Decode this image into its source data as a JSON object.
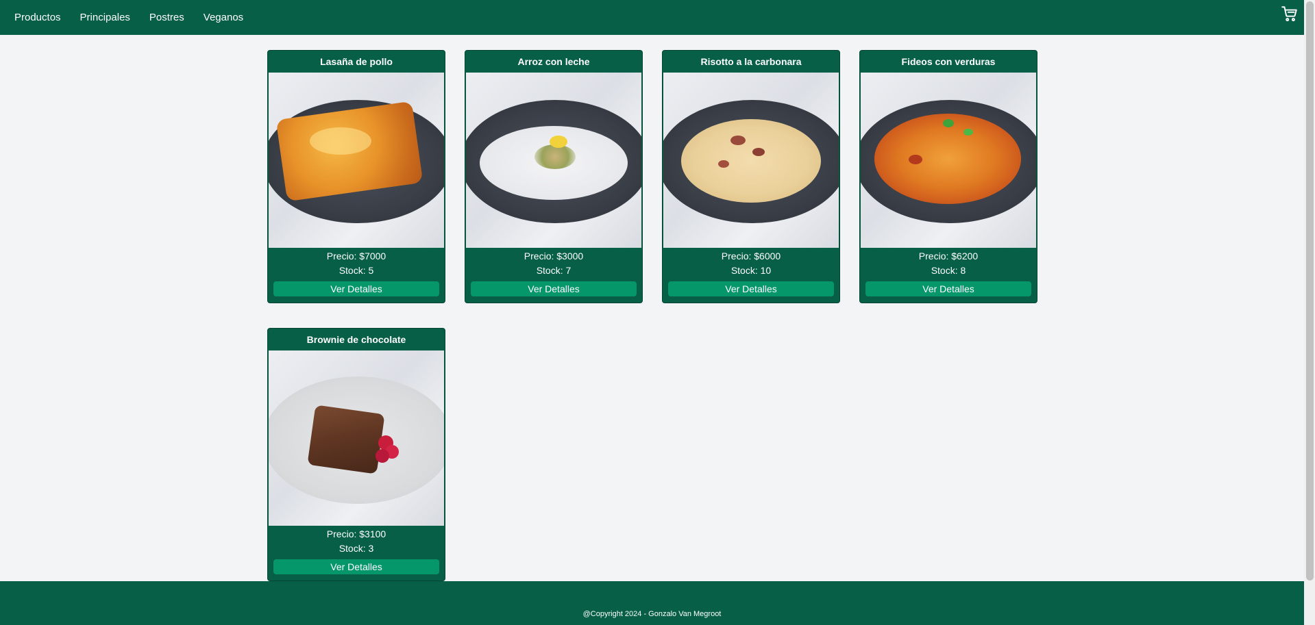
{
  "nav": {
    "links": [
      "Productos",
      "Principales",
      "Postres",
      "Veganos"
    ],
    "cart_icon": "cart-icon"
  },
  "products": [
    {
      "title": "Lasaña de pollo",
      "price": "Precio: $7000",
      "stock": "Stock: 5",
      "button": "Ver Detalles"
    },
    {
      "title": "Arroz con leche",
      "price": "Precio: $3000",
      "stock": "Stock: 7",
      "button": "Ver Detalles"
    },
    {
      "title": "Risotto a la carbonara",
      "price": "Precio: $6000",
      "stock": "Stock: 10",
      "button": "Ver Detalles"
    },
    {
      "title": "Fideos con verduras",
      "price": "Precio: $6200",
      "stock": "Stock: 8",
      "button": "Ver Detalles"
    },
    {
      "title": "Brownie de chocolate",
      "price": "Precio: $3100",
      "stock": "Stock: 3",
      "button": "Ver Detalles"
    }
  ],
  "footer": {
    "text": "@Copyright 2024 - Gonzalo Van Megroot"
  },
  "colors": {
    "primary": "#065f46",
    "button": "#059669",
    "background": "#f3f4f6"
  }
}
